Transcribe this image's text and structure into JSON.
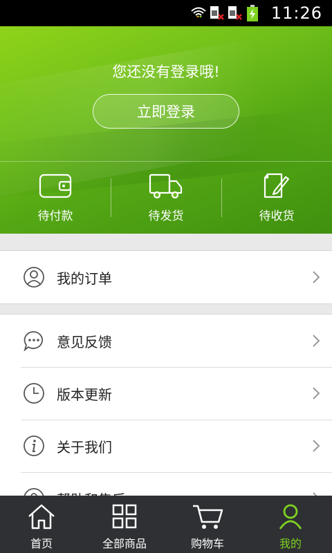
{
  "status_bar": {
    "time": "11:26"
  },
  "header": {
    "login_prompt": "您还没有登录哦!",
    "login_button": "立即登录",
    "order_status": [
      {
        "label": "待付款",
        "icon": "wallet-icon"
      },
      {
        "label": "待发货",
        "icon": "truck-icon"
      },
      {
        "label": "待收货",
        "icon": "signed-document-icon"
      }
    ]
  },
  "menu": {
    "orders": {
      "label": "我的订单",
      "icon": "user-circle-icon"
    },
    "feedback": {
      "label": "意见反馈",
      "icon": "chat-bubble-icon"
    },
    "update": {
      "label": "版本更新",
      "icon": "clock-icon"
    },
    "about": {
      "label": "关于我们",
      "icon": "info-icon"
    },
    "help": {
      "label": "帮助和售后",
      "icon": "help-icon"
    }
  },
  "bottom_nav": [
    {
      "label": "首页",
      "icon": "home-icon"
    },
    {
      "label": "全部商品",
      "icon": "grid-icon"
    },
    {
      "label": "购物车",
      "icon": "cart-icon"
    },
    {
      "label": "我的",
      "icon": "profile-icon",
      "active": true
    }
  ],
  "colors": {
    "accent": "#7ed321",
    "nav_bg": "#2f3033",
    "header_green": "#6fbe1a"
  }
}
